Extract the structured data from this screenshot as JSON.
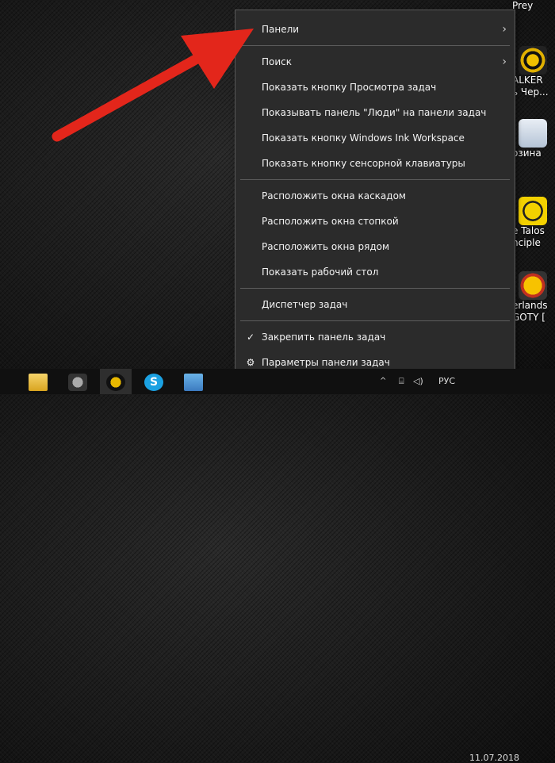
{
  "desktop": {
    "icons": [
      {
        "label1": "Prey",
        "label2": ""
      },
      {
        "label1": "ALKER",
        "label2": "ь Чер..."
      },
      {
        "label1": "озина",
        "label2": ""
      },
      {
        "label1": "e Talos",
        "label2": "nciple"
      },
      {
        "label1": "erlands",
        "label2": "GOTY ["
      }
    ]
  },
  "menu": {
    "items": [
      {
        "label": "Панели",
        "submenu": true
      },
      {
        "label": "Поиск",
        "submenu": true
      },
      {
        "label": "Показать кнопку Просмотра задач"
      },
      {
        "label": "Показывать панель \"Люди\" на панели задач"
      },
      {
        "label": "Показать кнопку Windows Ink Workspace"
      },
      {
        "label": "Показать кнопку сенсорной клавиатуры"
      },
      {
        "label": "Расположить окна каскадом"
      },
      {
        "label": "Расположить окна стопкой"
      },
      {
        "label": "Расположить окна рядом"
      },
      {
        "label": "Показать рабочий стол"
      },
      {
        "label": "Диспетчер задач"
      },
      {
        "label": "Закрепить панель задач",
        "checked": true
      },
      {
        "label": "Параметры панели задач",
        "icon": "gear-icon"
      }
    ],
    "submenu_glyph": "›",
    "check_glyph": "✓",
    "gear_glyph": "⚙"
  },
  "taskbar": {
    "tray": {
      "chevron": "^",
      "network": "⌸",
      "volume": "◁)",
      "language": "РУС",
      "date": "11.07.2018"
    },
    "skype_letter": "S"
  },
  "annotation": {
    "color": "#e3261b"
  }
}
